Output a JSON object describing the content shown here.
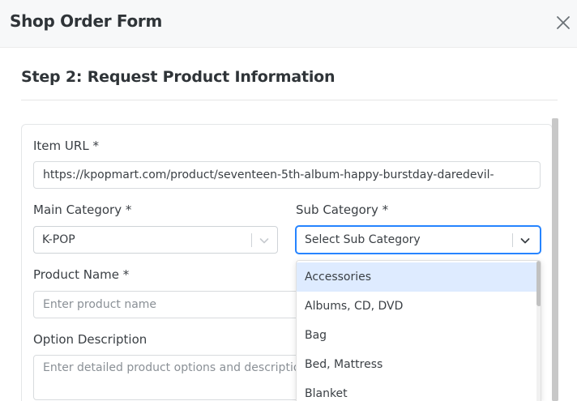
{
  "header": {
    "title": "Shop Order Form",
    "close_icon": "close-icon"
  },
  "step": {
    "title": "Step 2: Request Product Information"
  },
  "form": {
    "item_url": {
      "label": "Item URL *",
      "value": "https://kpopmart.com/product/seventeen-5th-album-happy-burstday-daredevil-"
    },
    "main_category": {
      "label": "Main Category *",
      "value": "K-POP"
    },
    "sub_category": {
      "label": "Sub Category *",
      "placeholder": "Select Sub Category"
    },
    "product_name": {
      "label": "Product Name *",
      "placeholder": "Enter product name"
    },
    "option_description": {
      "label": "Option Description",
      "placeholder": "Enter detailed product options and description"
    }
  },
  "dropdown": {
    "options": [
      "Accessories",
      "Albums, CD, DVD",
      "Bag",
      "Bed, Mattress",
      "Blanket"
    ],
    "highlighted_index": 0
  },
  "colors": {
    "focus": "#2684ff",
    "option_highlight": "#deebff",
    "header_bg": "#f7f8f9"
  }
}
